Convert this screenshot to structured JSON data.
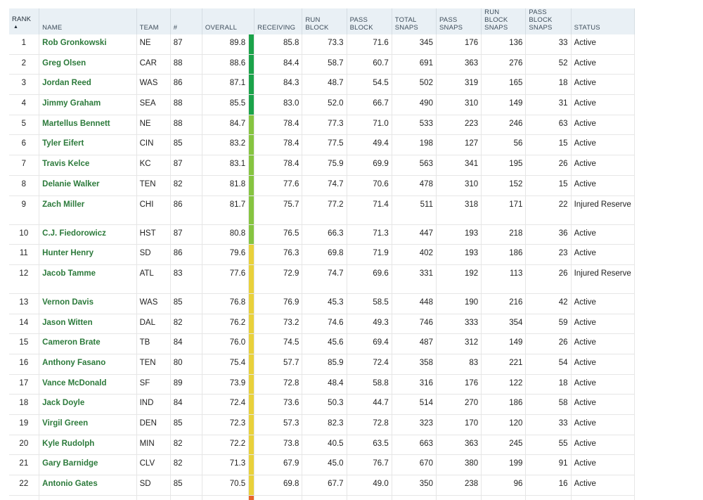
{
  "columns": {
    "rank": "RANK",
    "name": "NAME",
    "team": "TEAM",
    "number": "#",
    "overall": "OVERALL",
    "receiving": "RECEIVING",
    "run_block": "RUN BLOCK",
    "pass_block": "PASS BLOCK",
    "total_snaps": "TOTAL SNAPS",
    "pass_snaps": "PASS SNAPS",
    "run_block_snaps": "RUN BLOCK SNAPS",
    "pass_block_snaps": "PASS BLOCK SNAPS",
    "status": "STATUS"
  },
  "sort": {
    "column": "rank",
    "direction": "ascending",
    "indicator": "▲"
  },
  "grade_colors": {
    "elite": "#1aa34a",
    "good": "#86c440",
    "average": "#e9d13b",
    "below": "#f2a33a",
    "poor": "#e55a2b"
  },
  "rows": [
    {
      "rank": "1",
      "name": "Rob Gronkowski",
      "team": "NE",
      "number": "87",
      "overall": "89.8",
      "receiving": "85.8",
      "run_block": "73.3",
      "pass_block": "71.6",
      "total_snaps": "345",
      "pass_snaps": "176",
      "run_block_snaps": "136",
      "pass_block_snaps": "33",
      "status": "Active",
      "grade_color": "#1aa34a"
    },
    {
      "rank": "2",
      "name": "Greg Olsen",
      "team": "CAR",
      "number": "88",
      "overall": "88.6",
      "receiving": "84.4",
      "run_block": "58.7",
      "pass_block": "60.7",
      "total_snaps": "691",
      "pass_snaps": "363",
      "run_block_snaps": "276",
      "pass_block_snaps": "52",
      "status": "Active",
      "grade_color": "#1aa34a"
    },
    {
      "rank": "3",
      "name": "Jordan Reed",
      "team": "WAS",
      "number": "86",
      "overall": "87.1",
      "receiving": "84.3",
      "run_block": "48.7",
      "pass_block": "54.5",
      "total_snaps": "502",
      "pass_snaps": "319",
      "run_block_snaps": "165",
      "pass_block_snaps": "18",
      "status": "Active",
      "grade_color": "#1aa34a"
    },
    {
      "rank": "4",
      "name": "Jimmy Graham",
      "team": "SEA",
      "number": "88",
      "overall": "85.5",
      "receiving": "83.0",
      "run_block": "52.0",
      "pass_block": "66.7",
      "total_snaps": "490",
      "pass_snaps": "310",
      "run_block_snaps": "149",
      "pass_block_snaps": "31",
      "status": "Active",
      "grade_color": "#1aa34a"
    },
    {
      "rank": "5",
      "name": "Martellus Bennett",
      "team": "NE",
      "number": "88",
      "overall": "84.7",
      "receiving": "78.4",
      "run_block": "77.3",
      "pass_block": "71.0",
      "total_snaps": "533",
      "pass_snaps": "223",
      "run_block_snaps": "246",
      "pass_block_snaps": "63",
      "status": "Active",
      "grade_color": "#86c440"
    },
    {
      "rank": "6",
      "name": "Tyler Eifert",
      "team": "CIN",
      "number": "85",
      "overall": "83.2",
      "receiving": "78.4",
      "run_block": "77.5",
      "pass_block": "49.4",
      "total_snaps": "198",
      "pass_snaps": "127",
      "run_block_snaps": "56",
      "pass_block_snaps": "15",
      "status": "Active",
      "grade_color": "#86c440"
    },
    {
      "rank": "7",
      "name": "Travis Kelce",
      "team": "KC",
      "number": "87",
      "overall": "83.1",
      "receiving": "78.4",
      "run_block": "75.9",
      "pass_block": "69.9",
      "total_snaps": "563",
      "pass_snaps": "341",
      "run_block_snaps": "195",
      "pass_block_snaps": "26",
      "status": "Active",
      "grade_color": "#86c440"
    },
    {
      "rank": "8",
      "name": "Delanie Walker",
      "team": "TEN",
      "number": "82",
      "overall": "81.8",
      "receiving": "77.6",
      "run_block": "74.7",
      "pass_block": "70.6",
      "total_snaps": "478",
      "pass_snaps": "310",
      "run_block_snaps": "152",
      "pass_block_snaps": "15",
      "status": "Active",
      "grade_color": "#86c440"
    },
    {
      "rank": "9",
      "name": "Zach Miller",
      "team": "CHI",
      "number": "86",
      "overall": "81.7",
      "receiving": "75.7",
      "run_block": "77.2",
      "pass_block": "71.4",
      "total_snaps": "511",
      "pass_snaps": "318",
      "run_block_snaps": "171",
      "pass_block_snaps": "22",
      "status": "Injured Reserve",
      "grade_color": "#86c440",
      "tall": true
    },
    {
      "rank": "10",
      "name": "C.J. Fiedorowicz",
      "team": "HST",
      "number": "87",
      "overall": "80.8",
      "receiving": "76.5",
      "run_block": "66.3",
      "pass_block": "71.3",
      "total_snaps": "447",
      "pass_snaps": "193",
      "run_block_snaps": "218",
      "pass_block_snaps": "36",
      "status": "Active",
      "grade_color": "#86c440"
    },
    {
      "rank": "11",
      "name": "Hunter Henry",
      "team": "SD",
      "number": "86",
      "overall": "79.6",
      "receiving": "76.3",
      "run_block": "69.8",
      "pass_block": "71.9",
      "total_snaps": "402",
      "pass_snaps": "193",
      "run_block_snaps": "186",
      "pass_block_snaps": "23",
      "status": "Active",
      "grade_color": "#e9d13b"
    },
    {
      "rank": "12",
      "name": "Jacob Tamme",
      "team": "ATL",
      "number": "83",
      "overall": "77.6",
      "receiving": "72.9",
      "run_block": "74.7",
      "pass_block": "69.6",
      "total_snaps": "331",
      "pass_snaps": "192",
      "run_block_snaps": "113",
      "pass_block_snaps": "26",
      "status": "Injured Reserve",
      "grade_color": "#e9d13b",
      "tall": true
    },
    {
      "rank": "13",
      "name": "Vernon Davis",
      "team": "WAS",
      "number": "85",
      "overall": "76.8",
      "receiving": "76.9",
      "run_block": "45.3",
      "pass_block": "58.5",
      "total_snaps": "448",
      "pass_snaps": "190",
      "run_block_snaps": "216",
      "pass_block_snaps": "42",
      "status": "Active",
      "grade_color": "#e9d13b"
    },
    {
      "rank": "14",
      "name": "Jason Witten",
      "team": "DAL",
      "number": "82",
      "overall": "76.2",
      "receiving": "73.2",
      "run_block": "74.6",
      "pass_block": "49.3",
      "total_snaps": "746",
      "pass_snaps": "333",
      "run_block_snaps": "354",
      "pass_block_snaps": "59",
      "status": "Active",
      "grade_color": "#e9d13b"
    },
    {
      "rank": "15",
      "name": "Cameron Brate",
      "team": "TB",
      "number": "84",
      "overall": "76.0",
      "receiving": "74.5",
      "run_block": "45.6",
      "pass_block": "69.4",
      "total_snaps": "487",
      "pass_snaps": "312",
      "run_block_snaps": "149",
      "pass_block_snaps": "26",
      "status": "Active",
      "grade_color": "#e9d13b"
    },
    {
      "rank": "16",
      "name": "Anthony Fasano",
      "team": "TEN",
      "number": "80",
      "overall": "75.4",
      "receiving": "57.7",
      "run_block": "85.9",
      "pass_block": "72.4",
      "total_snaps": "358",
      "pass_snaps": "83",
      "run_block_snaps": "221",
      "pass_block_snaps": "54",
      "status": "Active",
      "grade_color": "#e9d13b"
    },
    {
      "rank": "17",
      "name": "Vance McDonald",
      "team": "SF",
      "number": "89",
      "overall": "73.9",
      "receiving": "72.8",
      "run_block": "48.4",
      "pass_block": "58.8",
      "total_snaps": "316",
      "pass_snaps": "176",
      "run_block_snaps": "122",
      "pass_block_snaps": "18",
      "status": "Active",
      "grade_color": "#e9d13b"
    },
    {
      "rank": "18",
      "name": "Jack Doyle",
      "team": "IND",
      "number": "84",
      "overall": "72.4",
      "receiving": "73.6",
      "run_block": "50.3",
      "pass_block": "44.7",
      "total_snaps": "514",
      "pass_snaps": "270",
      "run_block_snaps": "186",
      "pass_block_snaps": "58",
      "status": "Active",
      "grade_color": "#e9d13b"
    },
    {
      "rank": "19",
      "name": "Virgil Green",
      "team": "DEN",
      "number": "85",
      "overall": "72.3",
      "receiving": "57.3",
      "run_block": "82.3",
      "pass_block": "72.8",
      "total_snaps": "323",
      "pass_snaps": "170",
      "run_block_snaps": "120",
      "pass_block_snaps": "33",
      "status": "Active",
      "grade_color": "#e9d13b"
    },
    {
      "rank": "20",
      "name": "Kyle Rudolph",
      "team": "MIN",
      "number": "82",
      "overall": "72.2",
      "receiving": "73.8",
      "run_block": "40.5",
      "pass_block": "63.5",
      "total_snaps": "663",
      "pass_snaps": "363",
      "run_block_snaps": "245",
      "pass_block_snaps": "55",
      "status": "Active",
      "grade_color": "#e9d13b"
    },
    {
      "rank": "21",
      "name": "Gary Barnidge",
      "team": "CLV",
      "number": "82",
      "overall": "71.3",
      "receiving": "67.9",
      "run_block": "45.0",
      "pass_block": "76.7",
      "total_snaps": "670",
      "pass_snaps": "380",
      "run_block_snaps": "199",
      "pass_block_snaps": "91",
      "status": "Active",
      "grade_color": "#e9d13b"
    },
    {
      "rank": "22",
      "name": "Antonio Gates",
      "team": "SD",
      "number": "85",
      "overall": "70.5",
      "receiving": "69.8",
      "run_block": "67.7",
      "pass_block": "49.0",
      "total_snaps": "350",
      "pass_snaps": "238",
      "run_block_snaps": "96",
      "pass_block_snaps": "16",
      "status": "Active",
      "grade_color": "#e9d13b"
    }
  ],
  "partial_row_color": "#e8632b"
}
